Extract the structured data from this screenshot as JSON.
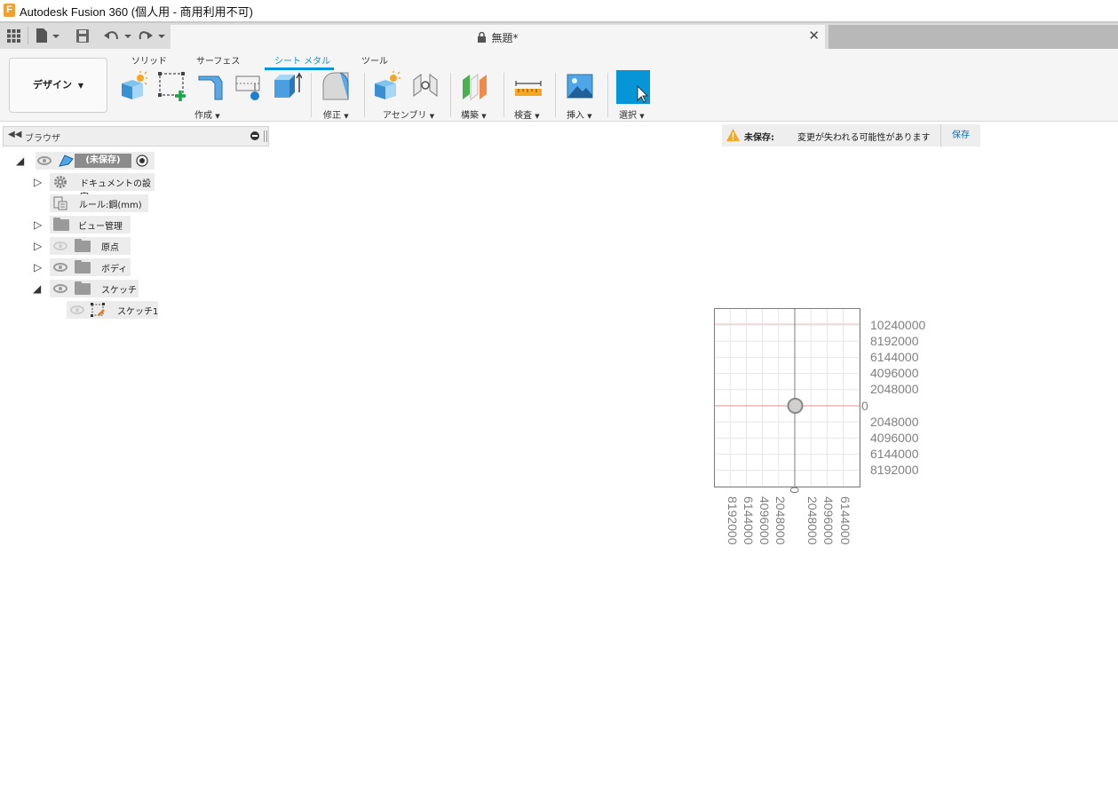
{
  "window": {
    "title": "Autodesk Fusion 360 (個人用 - 商用利用不可)",
    "logo_letter": "F"
  },
  "document_tab": {
    "title": "無題*",
    "lock_icon": "lock-icon",
    "close_icon": "close-icon"
  },
  "quick_access": {
    "icons": [
      "grid-menu-icon",
      "file-icon",
      "save-icon",
      "undo-icon",
      "redo-icon"
    ]
  },
  "ribbon": {
    "workspace": "デザイン",
    "tabs": [
      {
        "label": "ソリッド",
        "active": false
      },
      {
        "label": "サーフェス",
        "active": false
      },
      {
        "label": "シート メタル",
        "active": true
      },
      {
        "label": "ツール",
        "active": false
      }
    ],
    "groups": [
      {
        "label": "作成"
      },
      {
        "label": "修正"
      },
      {
        "label": "アセンブリ"
      },
      {
        "label": "構築"
      },
      {
        "label": "検査"
      },
      {
        "label": "挿入"
      },
      {
        "label": "選択"
      }
    ],
    "accent_color": "#0696d7"
  },
  "browser": {
    "title": "ブラウザ",
    "items": [
      {
        "label": "(未保存)"
      },
      {
        "label": "ドキュメントの設定"
      },
      {
        "label": "ルール:鋼(mm)"
      },
      {
        "label": "ビュー管理"
      },
      {
        "label": "原点"
      },
      {
        "label": "ボディ"
      },
      {
        "label": "スケッチ"
      },
      {
        "label": "スケッチ1"
      }
    ]
  },
  "unsaved_banner": {
    "label": "未保存:",
    "message": "変更が失われる可能性があります",
    "save": "保存",
    "warning_color": "#f5a623"
  },
  "viewport": {
    "y_labels": [
      "10240000",
      "8192000",
      "6144000",
      "4096000",
      "2048000",
      "0",
      "2048000",
      "4096000",
      "6144000",
      "8192000"
    ],
    "x_labels": [
      "8192000",
      "6144000",
      "4096000",
      "2048000",
      "0",
      "2048000",
      "4096000",
      "6144000"
    ]
  }
}
